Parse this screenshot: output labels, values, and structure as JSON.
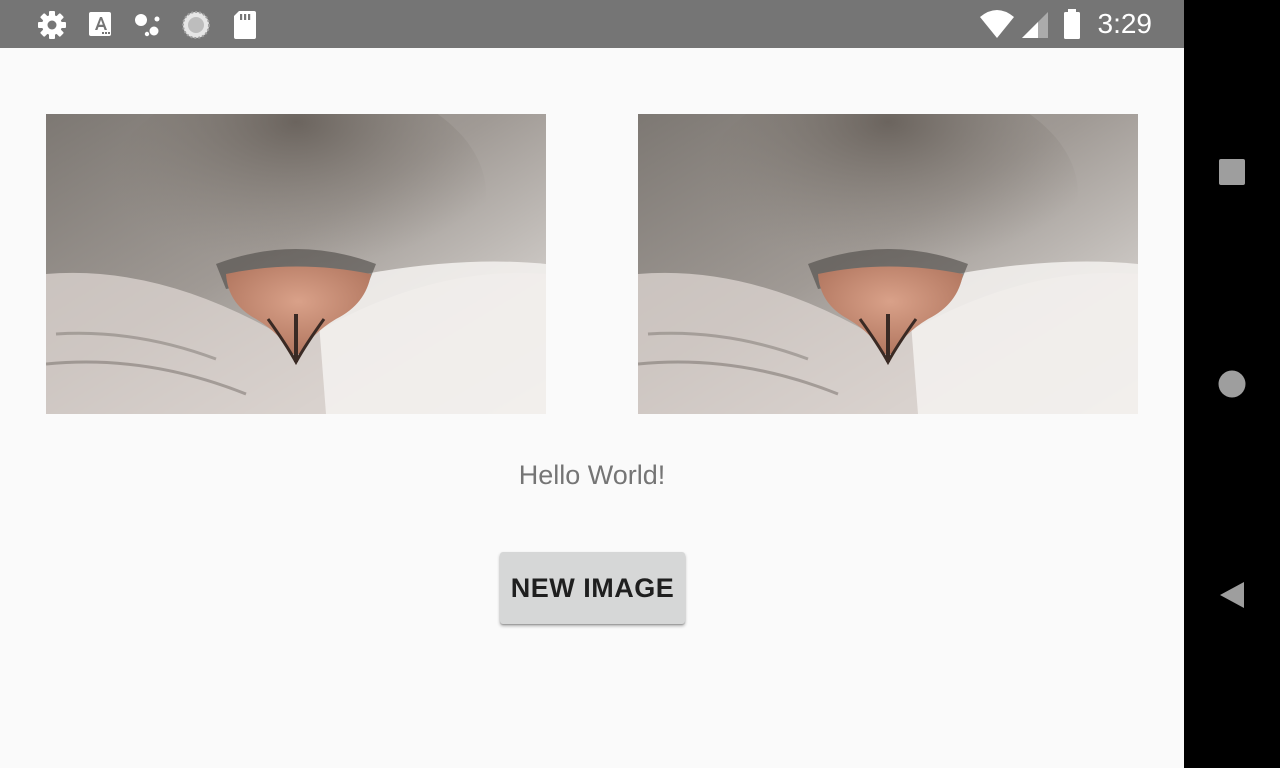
{
  "status_bar": {
    "time": "3:29",
    "left_icons": [
      "settings-icon",
      "font-a-icon",
      "assistant-dots-icon",
      "sync-circle-icon",
      "sd-card-icon"
    ],
    "right_icons": [
      "wifi-icon",
      "cell-signal-icon",
      "battery-icon"
    ]
  },
  "images": [
    {
      "name": "cat-nose-photo-left",
      "description_icon": "cat-nose-photo"
    },
    {
      "name": "cat-nose-photo-right",
      "description_icon": "cat-nose-photo"
    }
  ],
  "main": {
    "hello_text": "Hello World!",
    "new_image_button_label": "NEW IMAGE"
  },
  "nav_bar": {
    "buttons": [
      "recents-square-icon",
      "home-circle-icon",
      "back-triangle-icon"
    ]
  },
  "colors": {
    "status_bar": "#757575",
    "screen_background": "#fafafa",
    "nav_bar": "#000000",
    "button_background": "#d6d7d7"
  }
}
